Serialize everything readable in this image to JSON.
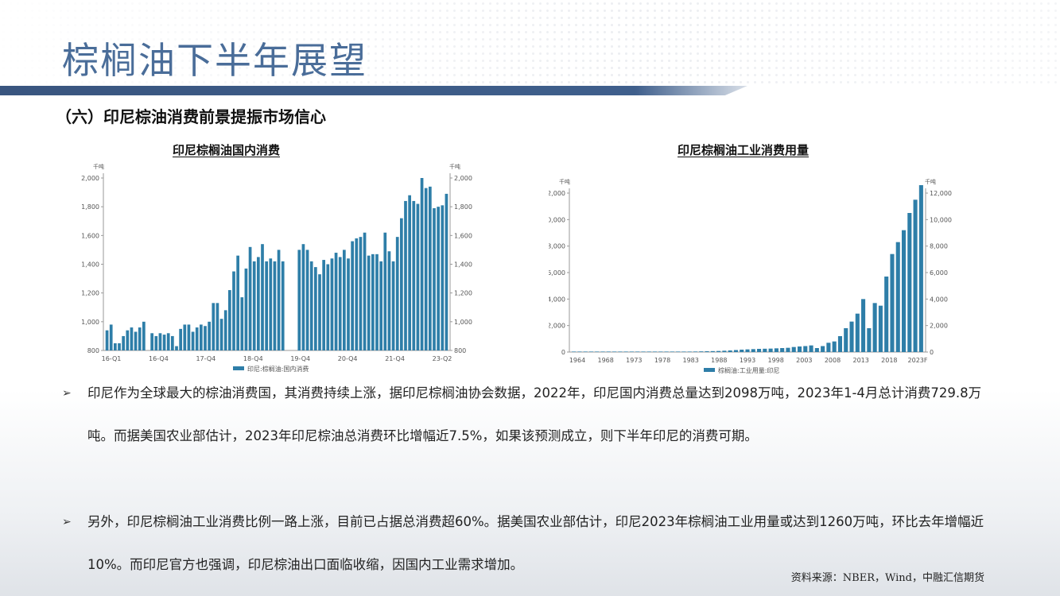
{
  "page": {
    "title": "棕榈油下半年展望",
    "section": "（六）印尼棕油消费前景提振市场信心",
    "source": "资料来源：NBER，Wind，中融汇信期货"
  },
  "bullets": [
    {
      "marker": "➢",
      "text": "印尼作为全球最大的棕油消费国，其消费持续上涨，据印尼棕榈油协会数据，2022年，印尼国内消费总量达到2098万吨，2023年1-4月总计消费729.8万吨。而据美国农业部估计，2023年印尼棕油总消费环比增幅近7.5%，如果该预测成立，则下半年印尼的消费可期。"
    },
    {
      "marker": "➢",
      "text": "另外，印尼棕榈油工业消费比例一路上涨，目前已占据总消费超60%。据美国农业部估计，印尼2023年棕榈油工业用量或达到1260万吨，环比去年增幅近10%。而印尼官方也强调，印尼棕油出口面临收缩，因国内工业需求增加。"
    }
  ],
  "colors": {
    "bar": "#2e7ea8",
    "title": "#4a6d99",
    "bar_band": "#3f5f8c"
  },
  "chart_data": [
    {
      "type": "bar",
      "title": "印尼棕榈油国内消费",
      "unit_left": "千吨",
      "unit_right": "千吨",
      "legend": "印尼:棕榈油:国内消费",
      "legend_position": "bottom",
      "ylim": [
        800,
        2000
      ],
      "yticks": [
        "800",
        "1,000",
        "1,200",
        "1,400",
        "1,600",
        "1,800",
        "2,000"
      ],
      "xticks": [
        "16-Q1",
        "16-Q4",
        "17-Q4",
        "18-Q4",
        "19-Q4",
        "20-Q4",
        "21-Q4",
        "23-Q2"
      ],
      "grid": false,
      "series": [
        {
          "name": "印尼:棕榈油:国内消费",
          "values": [
            940,
            980,
            850,
            850,
            900,
            940,
            960,
            930,
            960,
            1000,
            0,
            920,
            900,
            920,
            910,
            920,
            900,
            830,
            950,
            980,
            980,
            930,
            960,
            980,
            970,
            1000,
            1130,
            1130,
            1020,
            1080,
            1220,
            1350,
            1460,
            1170,
            1370,
            1520,
            1420,
            1450,
            1540,
            1420,
            1440,
            1420,
            1500,
            1420,
            0,
            0,
            0,
            1500,
            1540,
            1500,
            1420,
            1380,
            1330,
            1430,
            1400,
            1440,
            1480,
            1450,
            1500,
            1440,
            1560,
            1580,
            1590,
            1620,
            1460,
            1470,
            1470,
            1420,
            1620,
            1490,
            1420,
            1590,
            1720,
            1840,
            1880,
            1840,
            1820,
            2000,
            1930,
            1940,
            1790,
            1800,
            1810,
            1890
          ]
        }
      ]
    },
    {
      "type": "bar",
      "title": "印尼棕榈油工业消费用量",
      "unit_left": "千吨",
      "unit_right": "千吨",
      "legend": "棕榈油:工业用量:印尼",
      "legend_position": "bottom",
      "ylim": [
        0,
        12000
      ],
      "yticks": [
        "0",
        "2,000",
        "4,000",
        "6,000",
        "8,000",
        "10,000",
        "12,000"
      ],
      "xticks": [
        "1964",
        "1968",
        "1973",
        "1978",
        "1983",
        "1988",
        "1993",
        "1998",
        "2003",
        "2008",
        "2013",
        "2018",
        "2023F"
      ],
      "grid": false,
      "x": [
        1964,
        1965,
        1966,
        1967,
        1968,
        1969,
        1970,
        1971,
        1972,
        1973,
        1974,
        1975,
        1976,
        1977,
        1978,
        1979,
        1980,
        1981,
        1982,
        1983,
        1984,
        1985,
        1986,
        1987,
        1988,
        1989,
        1990,
        1991,
        1992,
        1993,
        1994,
        1995,
        1996,
        1997,
        1998,
        1999,
        2000,
        2001,
        2002,
        2003,
        2004,
        2005,
        2006,
        2007,
        2008,
        2009,
        2010,
        2011,
        2012,
        2013,
        2014,
        2015,
        2016,
        2017,
        2018,
        2019,
        2020,
        2021,
        2022,
        2023
      ],
      "series": [
        {
          "name": "棕榈油:工业用量:印尼",
          "values": [
            5,
            5,
            5,
            5,
            5,
            5,
            5,
            5,
            5,
            5,
            5,
            5,
            5,
            5,
            5,
            10,
            10,
            10,
            10,
            20,
            30,
            40,
            50,
            60,
            70,
            80,
            100,
            120,
            150,
            180,
            200,
            220,
            240,
            250,
            260,
            280,
            300,
            320,
            380,
            420,
            450,
            500,
            300,
            450,
            700,
            800,
            1200,
            1800,
            2300,
            2900,
            4000,
            1800,
            3700,
            3500,
            5700,
            7400,
            8300,
            9200,
            10500,
            11500,
            12600
          ]
        }
      ]
    }
  ]
}
